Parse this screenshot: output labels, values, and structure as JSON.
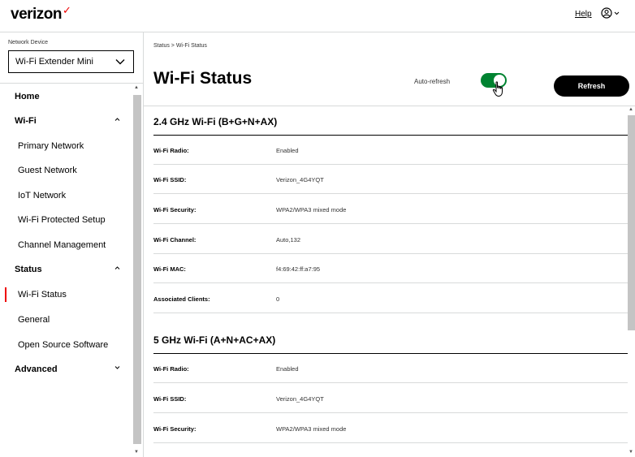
{
  "header": {
    "logo_text": "verizon",
    "logo_check": "✓",
    "help_label": "Help"
  },
  "sidebar": {
    "device_label": "Network Device",
    "device_selected": "Wi-Fi Extender Mini",
    "items": [
      {
        "label": "Home",
        "type": "head"
      },
      {
        "label": "Wi-Fi",
        "type": "head",
        "caret": "up"
      },
      {
        "label": "Primary Network",
        "type": "sub"
      },
      {
        "label": "Guest Network",
        "type": "sub"
      },
      {
        "label": "IoT Network",
        "type": "sub"
      },
      {
        "label": "Wi-Fi Protected Setup",
        "type": "sub"
      },
      {
        "label": "Channel Management",
        "type": "sub"
      },
      {
        "label": "Status",
        "type": "head",
        "caret": "up"
      },
      {
        "label": "Wi-Fi Status",
        "type": "sub",
        "active": true
      },
      {
        "label": "General",
        "type": "sub"
      },
      {
        "label": "Open Source Software",
        "type": "sub"
      },
      {
        "label": "Advanced",
        "type": "head",
        "caret": "down"
      }
    ]
  },
  "main": {
    "breadcrumb": "Status  >  Wi-Fi Status",
    "title": "Wi-Fi Status",
    "auto_refresh_label": "Auto-refresh",
    "auto_refresh_on": true,
    "refresh_label": "Refresh",
    "sections": [
      {
        "title": "2.4 GHz Wi-Fi (B+G+N+AX)",
        "rows": [
          {
            "label": "Wi-Fi Radio:",
            "value": "Enabled"
          },
          {
            "label": "Wi-Fi SSID:",
            "value": "Verizon_4G4YQT"
          },
          {
            "label": "Wi-Fi Security:",
            "value": "WPA2/WPA3 mixed mode"
          },
          {
            "label": "Wi-Fi Channel:",
            "value": "Auto,132"
          },
          {
            "label": "Wi-Fi MAC:",
            "value": "f4:69:42:ff:a7:95"
          },
          {
            "label": "Associated Clients:",
            "value": "0"
          }
        ]
      },
      {
        "title": "5 GHz Wi-Fi (A+N+AC+AX)",
        "rows": [
          {
            "label": "Wi-Fi Radio:",
            "value": "Enabled"
          },
          {
            "label": "Wi-Fi SSID:",
            "value": "Verizon_4G4YQT"
          },
          {
            "label": "Wi-Fi Security:",
            "value": "WPA2/WPA3 mixed mode"
          }
        ]
      }
    ]
  },
  "colors": {
    "brand_red": "#ee0000",
    "toggle_green": "#008331",
    "button_black": "#000000"
  }
}
